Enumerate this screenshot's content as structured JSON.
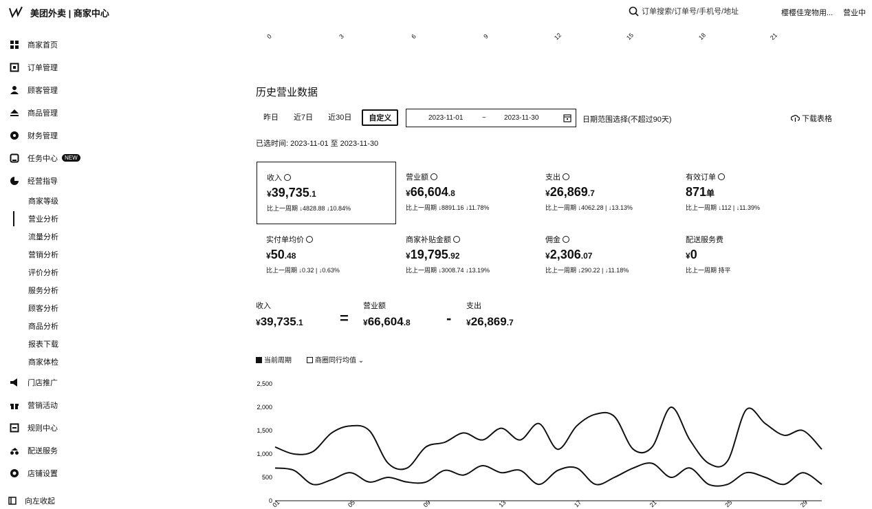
{
  "header": {
    "logo_text": "美团外卖 | 商家中心",
    "search_placeholder": "订单搜索/订单号/手机号/地址",
    "store_name": "樱樱佳宠物用...",
    "store_status": "营业中"
  },
  "sidebar": {
    "items": [
      {
        "label": "商家首页",
        "icon": "grid-icon"
      },
      {
        "label": "订单管理",
        "icon": "order-icon"
      },
      {
        "label": "顾客管理",
        "icon": "user-icon"
      },
      {
        "label": "商品管理",
        "icon": "goods-icon"
      },
      {
        "label": "财务管理",
        "icon": "finance-icon"
      },
      {
        "label": "任务中心",
        "icon": "task-icon",
        "badge": "NEW"
      },
      {
        "label": "经营指导",
        "icon": "chart-pie-icon"
      }
    ],
    "sub_items": [
      "商家等级",
      "营业分析",
      "流量分析",
      "营销分析",
      "评价分析",
      "服务分析",
      "顾客分析",
      "商品分析",
      "报表下载",
      "商家体检"
    ],
    "items_after": [
      {
        "label": "门店推广",
        "icon": "megaphone-icon"
      },
      {
        "label": "营销活动",
        "icon": "gift-icon"
      },
      {
        "label": "规则中心",
        "icon": "rules-icon"
      },
      {
        "label": "配送服务",
        "icon": "delivery-icon"
      },
      {
        "label": "店铺设置",
        "icon": "settings-icon"
      }
    ],
    "collapse_label": "向左收起"
  },
  "top_axis": [
    "0",
    "3",
    "6",
    "9",
    "12",
    "15",
    "18",
    "21"
  ],
  "section": {
    "title": "历史营业数据",
    "filters": [
      "昨日",
      "近7日",
      "近30日",
      "自定义"
    ],
    "date_start": "2023-11-01",
    "date_sep": "~",
    "date_end": "2023-11-30",
    "range_hint": "日期范围选择(不超过90天)",
    "download_label": "下载表格",
    "selected_time": "已选时间:  2023-11-01 至 2023-11-30"
  },
  "cards": [
    {
      "label": "收入",
      "cur": "¥",
      "int": "39,735",
      "dec": ".1",
      "cmp": "比上一周期 ↓4828.88  ↓10.84%"
    },
    {
      "label": "营业额",
      "cur": "¥",
      "int": "66,604",
      "dec": ".8",
      "cmp": "比上一周期 ↓8891.16  ↓11.78%"
    },
    {
      "label": "支出",
      "cur": "¥",
      "int": "26,869",
      "dec": ".7",
      "cmp": "比上一周期 ↓4062.28 | ↓13.13%"
    },
    {
      "label": "有效订单",
      "cur": "",
      "int": "871",
      "dec": "单",
      "cmp": "比上一周期 ↓112 | ↓11.39%"
    },
    {
      "label": "实付单均价",
      "cur": "¥",
      "int": "50",
      "dec": ".48",
      "cmp": "比上一周期 ↓0.32 | ↓0.63%"
    },
    {
      "label": "商家补贴金额",
      "cur": "¥",
      "int": "19,795",
      "dec": ".92",
      "cmp": "比上一周期 ↓3008.74  ↓13.19%"
    },
    {
      "label": "佣金",
      "cur": "¥",
      "int": "2,306",
      "dec": ".07",
      "cmp": "比上一周期 ↓290.22 | ↓11.18%"
    },
    {
      "label": "配送服务费",
      "cur": "¥",
      "int": "0",
      "dec": "",
      "cmp": "比上一周期  持平"
    }
  ],
  "formula": {
    "a_label": "收入",
    "a_int": "39,735",
    "a_dec": ".1",
    "op1": "=",
    "b_label": "营业额",
    "b_int": "66,604",
    "b_dec": ".8",
    "op2": "-",
    "c_label": "支出",
    "c_int": "26,869",
    "c_dec": ".7",
    "cur": "¥"
  },
  "legend": {
    "series1": "当前周期",
    "series2": "商圈同行均值"
  },
  "chart_data": {
    "type": "line",
    "yticks": [
      "0",
      "500",
      "1,000",
      "1,500",
      "2,000",
      "2,500"
    ],
    "ylim": [
      0,
      2500
    ],
    "xticks": [
      "01",
      "05",
      "09",
      "13",
      "17",
      "21",
      "25",
      "29"
    ],
    "x": [
      1,
      2,
      3,
      4,
      5,
      6,
      7,
      8,
      9,
      10,
      11,
      12,
      13,
      14,
      15,
      16,
      17,
      18,
      19,
      20,
      21,
      22,
      23,
      24,
      25,
      26,
      27,
      28,
      29,
      30
    ],
    "series": [
      {
        "name": "当前周期",
        "values": [
          1150,
          1000,
          1050,
          1450,
          1600,
          1500,
          800,
          700,
          1150,
          1250,
          1450,
          1300,
          1550,
          1300,
          1650,
          1100,
          1600,
          1850,
          1800,
          1100,
          1150,
          2000,
          1300,
          800,
          850,
          1950,
          1650,
          1400,
          1500,
          1100
        ]
      },
      {
        "name": "商圈同行均值",
        "values": [
          700,
          650,
          350,
          450,
          600,
          400,
          500,
          400,
          400,
          650,
          550,
          750,
          600,
          650,
          350,
          650,
          700,
          350,
          500,
          700,
          800,
          500,
          700,
          350,
          350,
          600,
          500,
          350,
          600,
          350
        ]
      }
    ]
  }
}
